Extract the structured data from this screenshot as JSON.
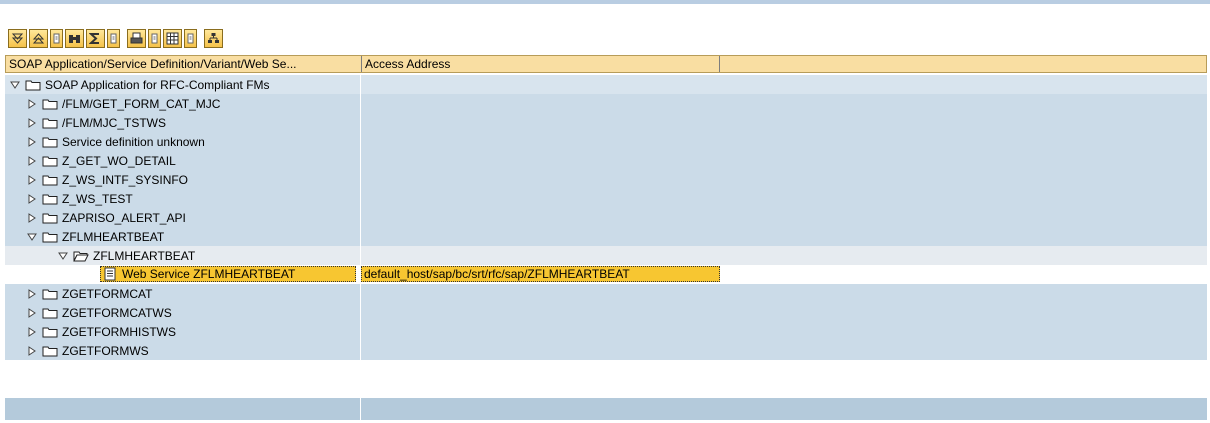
{
  "toolbar": {
    "buttons": [
      "expand-all-icon",
      "collapse-all-icon",
      "find-icon",
      "sum-icon",
      "print-icon",
      "layout-grid-icon",
      "hierarchy-icon"
    ]
  },
  "columns": {
    "col1": "SOAP Application/Service Definition/Variant/Web Se...",
    "col2": "Access Address"
  },
  "tree": {
    "root": "SOAP Application for RFC-Compliant FMs",
    "items": [
      "/FLM/GET_FORM_CAT_MJC",
      "/FLM/MJC_TSTWS",
      "Service definition unknown",
      "Z_GET_WO_DETAIL",
      "Z_WS_INTF_SYSINFO",
      "Z_WS_TEST",
      "ZAPRISO_ALERT_API",
      "ZFLMHEARTBEAT"
    ],
    "child": "ZFLMHEARTBEAT",
    "web_service": "Web Service ZFLMHEARTBEAT",
    "access_address": "default_host/sap/bc/srt/rfc/sap/ZFLMHEARTBEAT",
    "items_after": [
      "ZGETFORMCAT",
      "ZGETFORMCATWS",
      "ZGETFORMHISTWS",
      "ZGETFORMWS"
    ]
  },
  "colors": {
    "header_bg": "#f9dea2",
    "row_bg": "#cbdbe8",
    "selection": "#f7c631"
  }
}
